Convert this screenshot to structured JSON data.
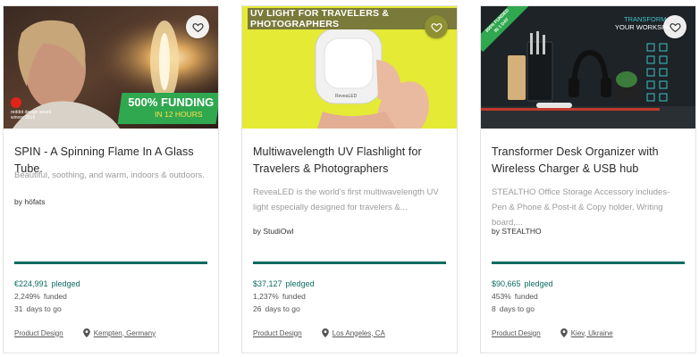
{
  "cards": [
    {
      "title": "SPIN - A Spinning Flame In A Glass Tube.",
      "description": "Beautiful, soothing, and warm, indoors & outdoors.",
      "creator_prefix": "by",
      "creator": "höfats",
      "pledged_amount": "€224,991",
      "pledged_label": "pledged",
      "funded_percent": "2,249%",
      "funded_label": "funded",
      "days_value": "31",
      "days_label": "days to go",
      "category": "Product Design",
      "location": "Kempten, Germany",
      "progress_fraction": 1.0,
      "image": {
        "banner_line1": "500% FUNDING",
        "banner_line2": "IN 12 HOURS",
        "award_line1": "reddot design award",
        "award_line2": "winner 2019"
      }
    },
    {
      "title": "Multiwavelength UV Flashlight for Travelers & Photographers",
      "description": "ReveaLED is the world's first multiwavelength UV light especially designed for travelers &...",
      "creator_prefix": "by",
      "creator": "StudiOwl",
      "pledged_amount": "$37,127",
      "pledged_label": "pledged",
      "funded_percent": "1,237%",
      "funded_label": "funded",
      "days_value": "26",
      "days_label": "days to go",
      "category": "Product Design",
      "location": "Los Angeles, CA",
      "progress_fraction": 1.0,
      "image": {
        "header": "UV LIGHT FOR TRAVELERS & PHOTOGRAPHERS",
        "device_label": "ReveaLED"
      }
    },
    {
      "title": "Transformer Desk Organizer with Wireless Charger & USB hub",
      "description": "STEALTHO Office Storage Accessory includes- Pen & Phone & Post-it & Copy holder, Writing board,...",
      "creator_prefix": "by",
      "creator": "STEALTHO",
      "pledged_amount": "$90,665",
      "pledged_label": "pledged",
      "funded_percent": "453%",
      "funded_label": "funded",
      "days_value": "8",
      "days_label": "days to go",
      "category": "Product Design",
      "location": "Kiev, Ukraine",
      "progress_fraction": 1.0,
      "image": {
        "ribbon_line1": "300% FUNDED",
        "ribbon_line2": "IN 1 DAY",
        "headline_line1": "TRANSFORM",
        "headline_line2": "YOUR WORKSPACE"
      }
    }
  ],
  "colors": {
    "accent": "#0c6b61",
    "muted_text": "#9b9b9b",
    "uv_yellow": "#e5ea35",
    "banner_green": "#2fa84f"
  },
  "icons": {
    "favorite": "heart-outline-icon",
    "location": "map-pin-icon"
  }
}
